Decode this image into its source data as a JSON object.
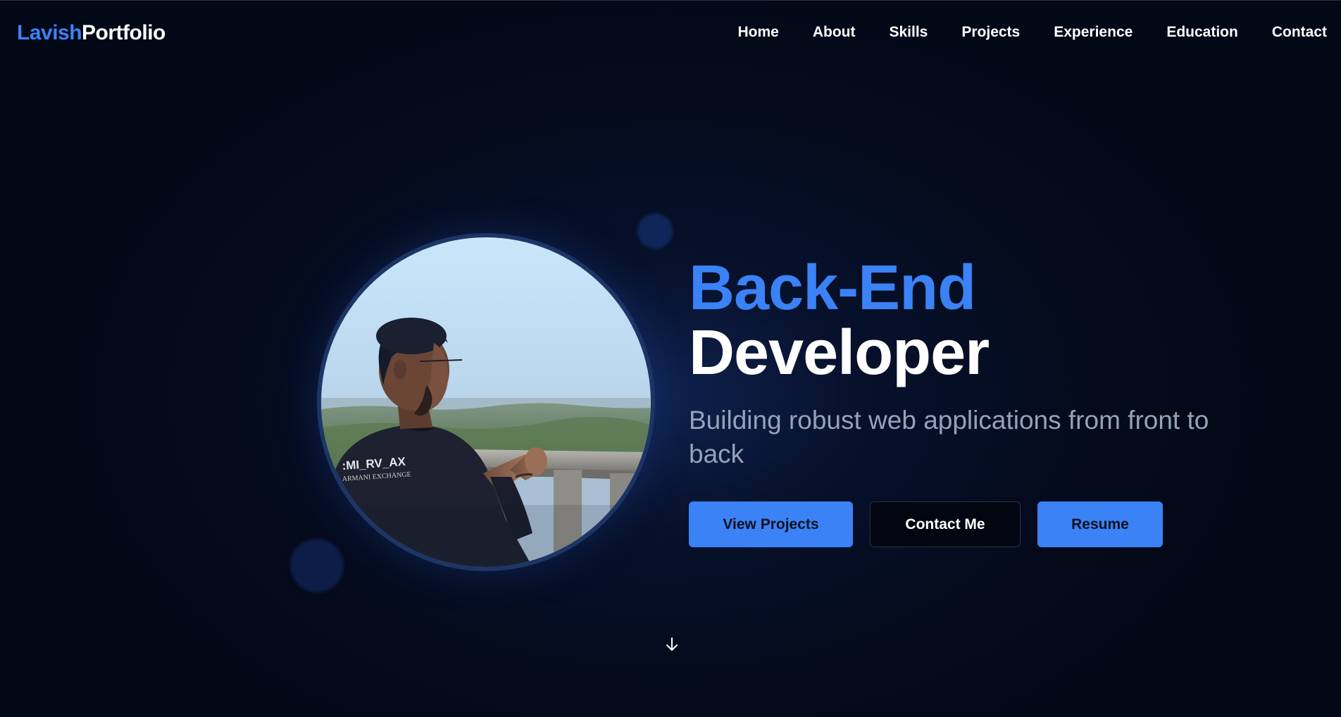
{
  "header": {
    "logo_accent": "Lavish",
    "logo_rest": "Portfolio",
    "nav": [
      {
        "label": "Home"
      },
      {
        "label": "About"
      },
      {
        "label": "Skills"
      },
      {
        "label": "Projects"
      },
      {
        "label": "Experience"
      },
      {
        "label": "Education"
      },
      {
        "label": "Contact"
      }
    ]
  },
  "hero": {
    "title_accent": "Back-End",
    "title_main": "Developer",
    "subtitle": "Building robust web applications from front to back",
    "buttons": {
      "view_projects": "View Projects",
      "contact_me": "Contact Me",
      "resume": "Resume"
    },
    "shirt_text_line1": ":MI_RV_AX",
    "shirt_text_line2": "ARMANI EXCHANGE"
  },
  "icons": {
    "scroll": "arrow-down-icon"
  },
  "colors": {
    "accent": "#3b82f6",
    "background": "#030816",
    "subtitle": "#94a3b8"
  }
}
